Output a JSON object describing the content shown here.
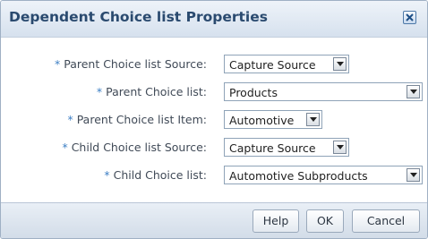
{
  "dialog": {
    "title": "Dependent Choice list Properties",
    "close_icon": "close-icon"
  },
  "required_marker": "*",
  "fields": [
    {
      "label": "Parent Choice list Source:",
      "value": "Capture Source"
    },
    {
      "label": "Parent Choice list:",
      "value": "Products"
    },
    {
      "label": "Parent Choice list Item:",
      "value": "Automotive"
    },
    {
      "label": "Child Choice list Source:",
      "value": "Capture Source"
    },
    {
      "label": "Child Choice list:",
      "value": "Automotive Subproducts"
    }
  ],
  "buttons": {
    "help": "Help",
    "ok": "OK",
    "cancel": "Cancel"
  },
  "colors": {
    "title_text": "#2a4a6f",
    "required_marker": "#3d7fc4",
    "label_text": "#404a57"
  }
}
